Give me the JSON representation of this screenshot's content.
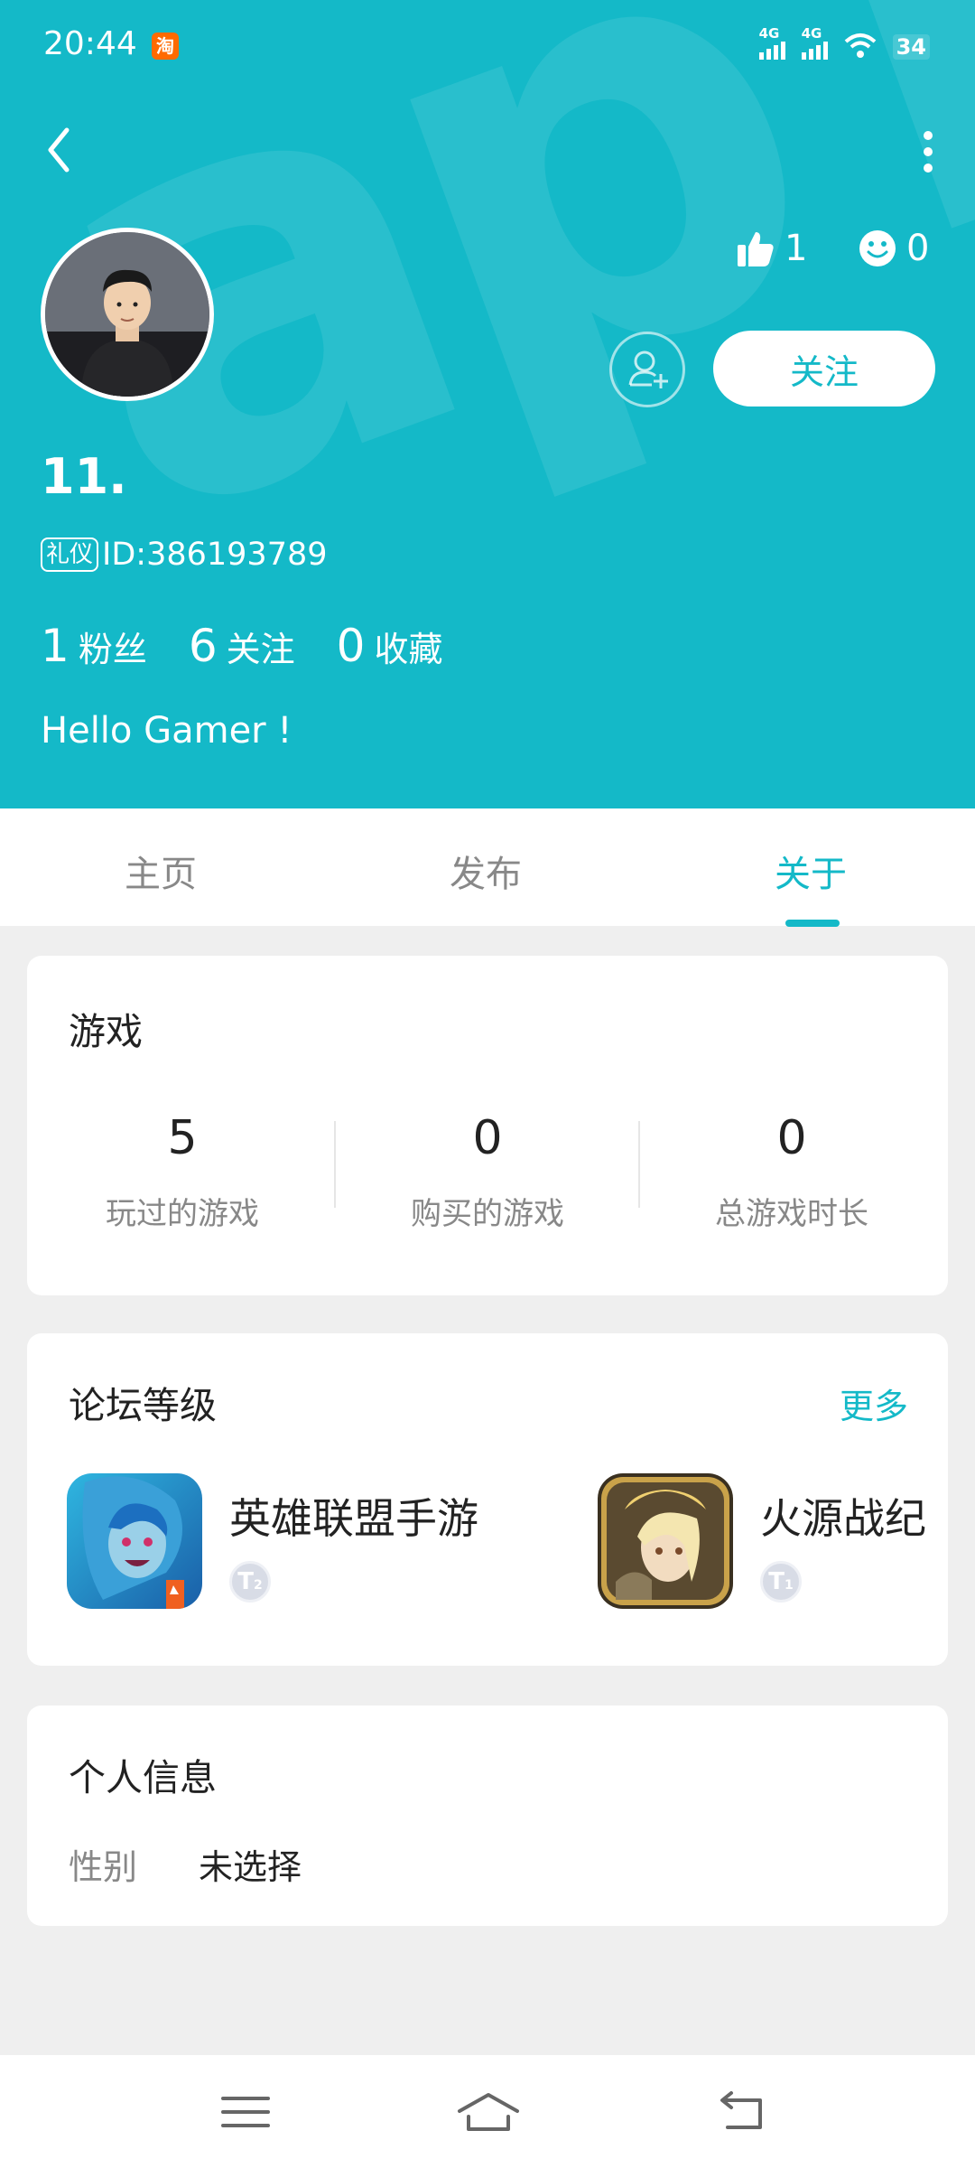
{
  "status_bar": {
    "time": "20:44",
    "app_badge": "淘",
    "signal1": "4G",
    "signal2": "4G",
    "battery": "34"
  },
  "header": {
    "watermark": "apTa",
    "username": "11.",
    "badge": "礼仪",
    "user_id": "ID:386193789",
    "likes": "1",
    "reactions": "0",
    "follow_label": "关注",
    "counts": [
      {
        "num": "1",
        "label": "粉丝"
      },
      {
        "num": "6",
        "label": "关注"
      },
      {
        "num": "0",
        "label": "收藏"
      }
    ],
    "bio": "Hello Gamer !"
  },
  "tabs": [
    {
      "label": "主页",
      "active": false
    },
    {
      "label": "发布",
      "active": false
    },
    {
      "label": "关于",
      "active": true
    }
  ],
  "games_card": {
    "title": "游戏",
    "stats": [
      {
        "num": "5",
        "label": "玩过的游戏"
      },
      {
        "num": "0",
        "label": "购买的游戏"
      },
      {
        "num": "0",
        "label": "总游戏时长"
      }
    ]
  },
  "forum_card": {
    "title": "论坛等级",
    "more": "更多",
    "items": [
      {
        "name": "英雄联盟手游",
        "level": "2"
      },
      {
        "name": "火源战纪",
        "level": "1"
      }
    ]
  },
  "info_card": {
    "title": "个人信息",
    "rows": [
      {
        "label": "性别",
        "value": "未选择"
      }
    ]
  },
  "colors": {
    "accent": "#14b9c8",
    "background": "#efefef"
  }
}
